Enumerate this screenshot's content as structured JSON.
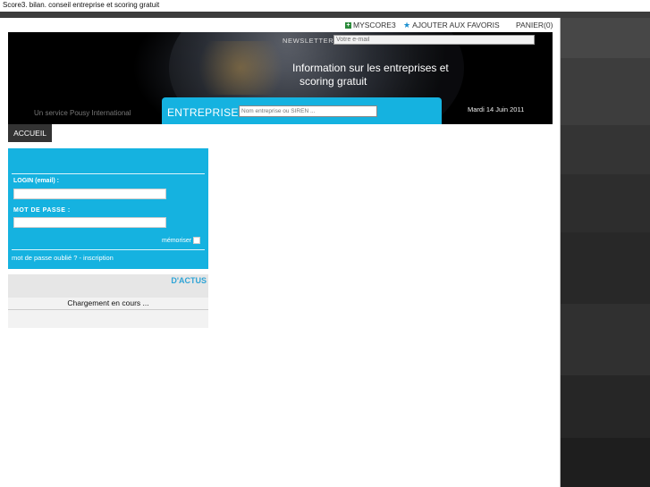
{
  "window": {
    "title": "Score3. bilan. conseil entreprise et scoring gratuit"
  },
  "topnav": {
    "myscore": "MYSCORE3",
    "favoris": "AJOUTER AUX FAVORIS",
    "panier": "PANIER(0)"
  },
  "banner": {
    "newsletter_label": "NEWSLETTER",
    "newsletter_placeholder": "Votre e-mail",
    "headline_line1": "Information sur les entreprises et",
    "headline_line2": "scoring gratuit",
    "service": "Un service Pousy International",
    "date": "Mardi 14 Juin 2011"
  },
  "search": {
    "label": "ENTREPRISE",
    "placeholder": "Nom entreprise ou SIREN ..."
  },
  "menu": {
    "accueil": "ACCUEIL"
  },
  "login": {
    "login_label": "LOGIN (email) :",
    "login_value": "",
    "password_label": "MOT DE PASSE :",
    "password_value": "",
    "remember_label": "mémoriser",
    "forgot_link": "mot de passe oublié ? - inscription"
  },
  "actus": {
    "title": "D'ACTUS",
    "loading": "Chargement en cours ..."
  },
  "colors": {
    "accent": "#15b2e0",
    "dark": "#333333",
    "actus_title": "#2fa4d6"
  }
}
